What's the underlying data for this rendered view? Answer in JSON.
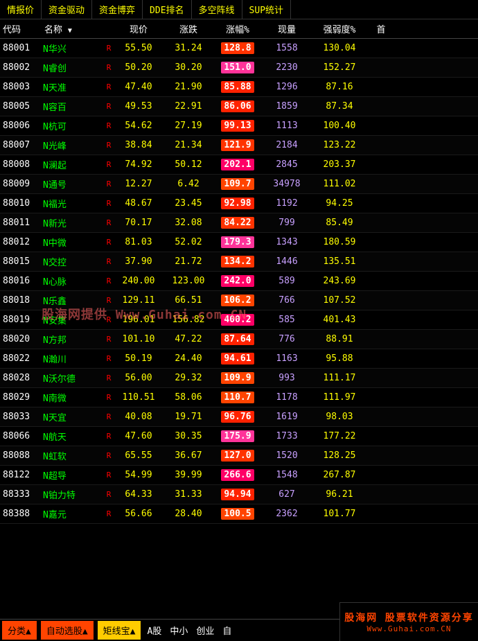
{
  "tabs": [
    {
      "id": "qingbao",
      "label": "情报价",
      "active": false
    },
    {
      "id": "zijinqudong",
      "label": "资金驱动",
      "active": false
    },
    {
      "id": "zijinboyi",
      "label": "资金博弈",
      "active": false
    },
    {
      "id": "dde",
      "label": "DDE排名",
      "active": false
    },
    {
      "id": "duokong",
      "label": "多空阵线",
      "active": false
    },
    {
      "id": "sup",
      "label": "SUP统计",
      "active": false
    }
  ],
  "header": {
    "cols": [
      "代码",
      "名称",
      "",
      "现价",
      "涨跌",
      "涨幅%",
      "现量",
      "强弱度%",
      "首"
    ]
  },
  "rows": [
    {
      "code": "88001",
      "name": "N华兴",
      "r": "R",
      "price": "55.50",
      "change": "31.24",
      "pct": "128.8",
      "volume": "1558",
      "strength": "130.04"
    },
    {
      "code": "88002",
      "name": "N睿创",
      "r": "R",
      "price": "50.20",
      "change": "30.20",
      "pct": "151.0",
      "volume": "2230",
      "strength": "152.27"
    },
    {
      "code": "88003",
      "name": "N天准",
      "r": "R",
      "price": "47.40",
      "change": "21.90",
      "pct": "85.88",
      "volume": "1296",
      "strength": "87.16"
    },
    {
      "code": "88005",
      "name": "N容百",
      "r": "R",
      "price": "49.53",
      "change": "22.91",
      "pct": "86.06",
      "volume": "1859",
      "strength": "87.34"
    },
    {
      "code": "88006",
      "name": "N杭可",
      "r": "R",
      "price": "54.62",
      "change": "27.19",
      "pct": "99.13",
      "volume": "1113",
      "strength": "100.40"
    },
    {
      "code": "88007",
      "name": "N光峰",
      "r": "R",
      "price": "38.84",
      "change": "21.34",
      "pct": "121.9",
      "volume": "2184",
      "strength": "123.22"
    },
    {
      "code": "88008",
      "name": "N澜起",
      "r": "R",
      "price": "74.92",
      "change": "50.12",
      "pct": "202.1",
      "volume": "2845",
      "strength": "203.37"
    },
    {
      "code": "88009",
      "name": "N通号",
      "r": "R",
      "price": "12.27",
      "change": "6.42",
      "pct": "109.7",
      "volume": "34978",
      "strength": "111.02"
    },
    {
      "code": "88010",
      "name": "N福光",
      "r": "R",
      "price": "48.67",
      "change": "23.45",
      "pct": "92.98",
      "volume": "1192",
      "strength": "94.25"
    },
    {
      "code": "88011",
      "name": "N新光",
      "r": "R",
      "price": "70.17",
      "change": "32.08",
      "pct": "84.22",
      "volume": "799",
      "strength": "85.49"
    },
    {
      "code": "88012",
      "name": "N中微",
      "r": "R",
      "price": "81.03",
      "change": "52.02",
      "pct": "179.3",
      "volume": "1343",
      "strength": "180.59"
    },
    {
      "code": "88015",
      "name": "N交控",
      "r": "R",
      "price": "37.90",
      "change": "21.72",
      "pct": "134.2",
      "volume": "1446",
      "strength": "135.51"
    },
    {
      "code": "88016",
      "name": "N心脉",
      "r": "R",
      "price": "...",
      "change": "...",
      "pct": "...",
      "volume": "...",
      "strength": "243.69",
      "watermark": true
    },
    {
      "code": "88018",
      "name": "N乐鑫",
      "r": "R",
      "price": "129.11",
      "change": "66.51",
      "pct": "106.2",
      "volume": "766",
      "strength": "107.52"
    },
    {
      "code": "88019",
      "name": "N安集",
      "r": "R",
      "price": "196.01",
      "change": "156.82",
      "pct": "400.2",
      "volume": "585",
      "strength": "401.43"
    },
    {
      "code": "88020",
      "name": "N方邦",
      "r": "R",
      "price": "101.10",
      "change": "47.22",
      "pct": "87.64",
      "volume": "776",
      "strength": "88.91"
    },
    {
      "code": "88022",
      "name": "N瀚川",
      "r": "R",
      "price": "50.19",
      "change": "24.40",
      "pct": "94.61",
      "volume": "1163",
      "strength": "95.88"
    },
    {
      "code": "88028",
      "name": "N沃尔德",
      "r": "R",
      "price": "56.00",
      "change": "29.32",
      "pct": "109.9",
      "volume": "993",
      "strength": "111.17"
    },
    {
      "code": "88029",
      "name": "N南微",
      "r": "R",
      "price": "110.51",
      "change": "58.06",
      "pct": "110.7",
      "volume": "1178",
      "strength": "111.97"
    },
    {
      "code": "88033",
      "name": "N天宜",
      "r": "R",
      "price": "40.08",
      "change": "19.71",
      "pct": "96.76",
      "volume": "1619",
      "strength": "98.03"
    },
    {
      "code": "88066",
      "name": "N航天",
      "r": "R",
      "price": "47.60",
      "change": "30.35",
      "pct": "175.9",
      "volume": "1733",
      "strength": "177.22"
    },
    {
      "code": "88088",
      "name": "N虹软",
      "r": "R",
      "price": "65.55",
      "change": "36.67",
      "pct": "127.0",
      "volume": "1520",
      "strength": "128.25"
    },
    {
      "code": "88122",
      "name": "N超导",
      "r": "R",
      "price": "54.99",
      "change": "39.99",
      "pct": "266.6",
      "volume": "1548",
      "strength": "267.87"
    },
    {
      "code": "88333",
      "name": "N铂力特",
      "r": "R",
      "price": "64.33",
      "change": "31.33",
      "pct": "94.94",
      "volume": "627",
      "strength": "96.21"
    },
    {
      "code": "88388",
      "name": "N嘉元",
      "r": "R",
      "price": "56.66",
      "change": "28.40",
      "pct": "100.5",
      "volume": "2362",
      "strength": "101.77"
    }
  ],
  "bottom": {
    "btn1": "分类▲",
    "btn2": "自动选股▲",
    "btn3": "矩线宝▲",
    "labels": [
      "A股",
      "中小",
      "创业",
      "自"
    ],
    "logo_line1": "股海网 股票软件资源分享",
    "logo_line2": "Www.Guhai.com.CN"
  },
  "watermark": {
    "text": "股海网提供 Www.Guhai.com.CN"
  }
}
